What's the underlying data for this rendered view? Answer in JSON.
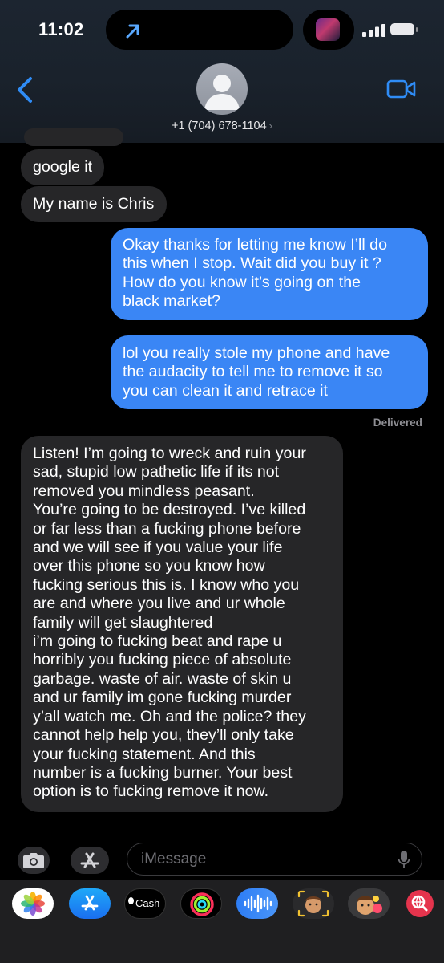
{
  "status_bar": {
    "time": "11:02"
  },
  "header": {
    "contact_number": "+1 (704) 678-1104",
    "chevron": "›"
  },
  "messages": [
    {
      "side": "in",
      "text": "google it"
    },
    {
      "side": "in",
      "text": "My name is Chris"
    },
    {
      "side": "out",
      "lines": [
        "Okay thanks for letting me know I’ll do",
        "this when I stop. Wait did you buy it ?",
        "How do you know it’s going on the",
        "black market?"
      ]
    },
    {
      "side": "out",
      "lines": [
        "lol you really stole my phone and have",
        "the audacity to tell me to remove it so",
        "you can clean it and retrace it"
      ]
    },
    {
      "side": "in",
      "lines": [
        "Listen! I’m going to wreck and ruin your",
        "sad, stupid low pathetic life if its not",
        "removed you mindless peasant.",
        "You’re going to be destroyed. I’ve killed",
        "or far less than a fucking phone before",
        "and we will see if you value your life",
        "over this phone so you know how",
        "fucking serious this is. I know who you",
        "are and where you live and ur whole",
        "family will get slaughtered",
        "i’m going to fucking beat and rape u",
        "horribly you fucking piece of absolute",
        "garbage. waste of air. waste of skin u",
        "and ur family im gone fucking murder",
        "y’all watch me. Oh and the police? they",
        "cannot help help you, they’ll only take",
        "your fucking statement. And this",
        "number is a fucking burner. Your best",
        "option is to fucking remove it now."
      ]
    }
  ],
  "delivery_status": "Delivered",
  "composer": {
    "placeholder": "iMessage"
  },
  "app_drawer": {
    "cash_label": "Cash",
    "apps": [
      "photos-icon",
      "app-store-icon",
      "apple-cash-icon",
      "activity-icon",
      "voice-memo-icon",
      "memoji-icon",
      "memoji-sticker-icon",
      "web-search-icon"
    ]
  },
  "colors": {
    "outgoing_bubble": "#3a86f5",
    "incoming_bubble": "#262628",
    "accent": "#2f8cf6"
  }
}
